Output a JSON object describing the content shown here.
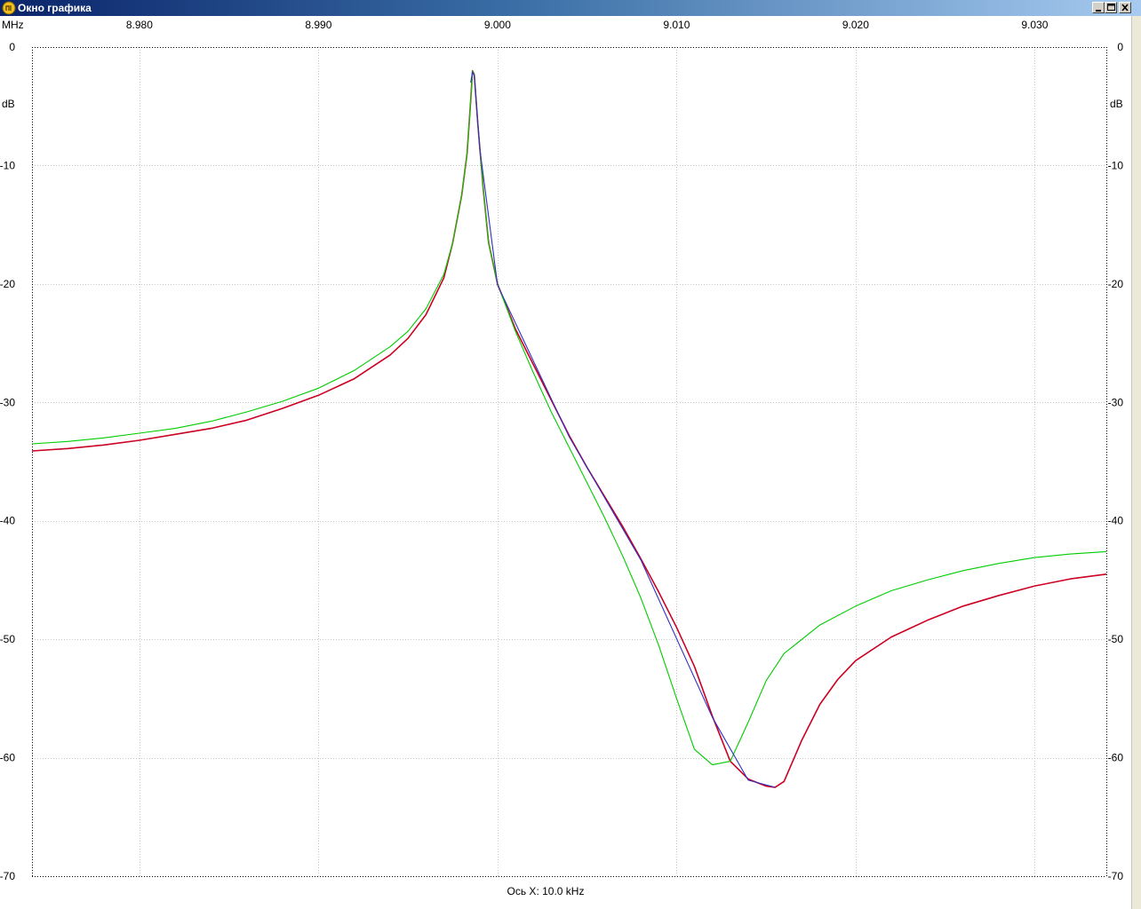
{
  "window": {
    "title": "Окно графика",
    "buttons": [
      "minimize",
      "maximize",
      "close"
    ]
  },
  "chart_data": {
    "type": "line",
    "x_unit": "MHz",
    "y_unit": "dB",
    "xlim": [
      8.974,
      9.034
    ],
    "ylim": [
      -70,
      0
    ],
    "x_ticks": [
      {
        "value": 8.98,
        "label": "8.980"
      },
      {
        "value": 8.99,
        "label": "8.990"
      },
      {
        "value": 9.0,
        "label": "9.000"
      },
      {
        "value": 9.01,
        "label": "9.010"
      },
      {
        "value": 9.02,
        "label": "9.020"
      },
      {
        "value": 9.03,
        "label": "9.030"
      }
    ],
    "y_ticks": [
      {
        "value": 0,
        "label": "0"
      },
      {
        "value": -10,
        "label": "-10"
      },
      {
        "value": -20,
        "label": "-20"
      },
      {
        "value": -30,
        "label": "-30"
      },
      {
        "value": -40,
        "label": "-40"
      },
      {
        "value": -50,
        "label": "-50"
      },
      {
        "value": -60,
        "label": "-60"
      },
      {
        "value": -70,
        "label": "-70"
      }
    ],
    "x_axis_caption": "Ось X: 10.0 kHz",
    "grid": true,
    "series": [
      {
        "color": "#cc0022",
        "points": [
          [
            8.974,
            -34.1
          ],
          [
            8.976,
            -33.9
          ],
          [
            8.978,
            -33.6
          ],
          [
            8.98,
            -33.2
          ],
          [
            8.982,
            -32.7
          ],
          [
            8.984,
            -32.2
          ],
          [
            8.986,
            -31.5
          ],
          [
            8.988,
            -30.5
          ],
          [
            8.99,
            -29.4
          ],
          [
            8.992,
            -28.0
          ],
          [
            8.994,
            -26.0
          ],
          [
            8.995,
            -24.6
          ],
          [
            8.996,
            -22.6
          ],
          [
            8.997,
            -19.5
          ],
          [
            8.9975,
            -16.5
          ],
          [
            8.998,
            -12.5
          ],
          [
            8.9983,
            -9.0
          ],
          [
            8.9985,
            -4.5
          ],
          [
            8.9986,
            -2.0
          ],
          [
            8.9987,
            -2.3
          ],
          [
            8.9989,
            -6.5
          ],
          [
            8.9992,
            -12.0
          ],
          [
            8.9995,
            -16.5
          ],
          [
            9.0,
            -20.0
          ],
          [
            9.001,
            -23.8
          ],
          [
            9.002,
            -26.8
          ],
          [
            9.003,
            -29.8
          ],
          [
            9.004,
            -32.8
          ],
          [
            9.005,
            -35.5
          ],
          [
            9.006,
            -38.0
          ],
          [
            9.007,
            -40.5
          ],
          [
            9.008,
            -43.2
          ],
          [
            9.009,
            -46.0
          ],
          [
            9.01,
            -49.0
          ],
          [
            9.011,
            -52.3
          ],
          [
            9.012,
            -56.5
          ],
          [
            9.013,
            -60.3
          ],
          [
            9.014,
            -61.8
          ],
          [
            9.015,
            -62.4
          ],
          [
            9.0155,
            -62.5
          ],
          [
            9.016,
            -62.0
          ],
          [
            9.017,
            -58.5
          ],
          [
            9.018,
            -55.5
          ],
          [
            9.019,
            -53.4
          ],
          [
            9.02,
            -51.8
          ],
          [
            9.022,
            -49.8
          ],
          [
            9.024,
            -48.4
          ],
          [
            9.026,
            -47.2
          ],
          [
            9.028,
            -46.3
          ],
          [
            9.03,
            -45.5
          ],
          [
            9.032,
            -44.9
          ],
          [
            9.034,
            -44.5
          ]
        ]
      },
      {
        "color": "#00cc00",
        "points": [
          [
            8.974,
            -33.5
          ],
          [
            8.976,
            -33.3
          ],
          [
            8.978,
            -33.0
          ],
          [
            8.98,
            -32.6
          ],
          [
            8.982,
            -32.2
          ],
          [
            8.984,
            -31.6
          ],
          [
            8.986,
            -30.8
          ],
          [
            8.988,
            -29.9
          ],
          [
            8.99,
            -28.8
          ],
          [
            8.992,
            -27.3
          ],
          [
            8.994,
            -25.3
          ],
          [
            8.995,
            -24.0
          ],
          [
            8.996,
            -22.1
          ],
          [
            8.997,
            -19.2
          ],
          [
            8.9975,
            -16.5
          ],
          [
            8.998,
            -12.5
          ],
          [
            8.9983,
            -9.0
          ],
          [
            8.9985,
            -4.5
          ],
          [
            8.9986,
            -2.0
          ],
          [
            8.9987,
            -2.3
          ],
          [
            8.9989,
            -6.5
          ],
          [
            8.9992,
            -12.0
          ],
          [
            8.9995,
            -16.5
          ],
          [
            9.0,
            -20.0
          ],
          [
            9.001,
            -24.0
          ],
          [
            9.002,
            -27.5
          ],
          [
            9.003,
            -30.8
          ],
          [
            9.004,
            -33.8
          ],
          [
            9.005,
            -36.8
          ],
          [
            9.006,
            -39.8
          ],
          [
            9.007,
            -43.0
          ],
          [
            9.008,
            -46.5
          ],
          [
            9.009,
            -50.5
          ],
          [
            9.01,
            -55.0
          ],
          [
            9.011,
            -59.3
          ],
          [
            9.012,
            -60.6
          ],
          [
            9.013,
            -60.3
          ],
          [
            9.014,
            -57.0
          ],
          [
            9.015,
            -53.5
          ],
          [
            9.016,
            -51.2
          ],
          [
            9.018,
            -48.8
          ],
          [
            9.02,
            -47.2
          ],
          [
            9.022,
            -45.9
          ],
          [
            9.024,
            -45.0
          ],
          [
            9.026,
            -44.2
          ],
          [
            9.028,
            -43.6
          ],
          [
            9.03,
            -43.1
          ],
          [
            9.032,
            -42.8
          ],
          [
            9.034,
            -42.6
          ]
        ]
      },
      {
        "color": "#3030c0",
        "points": [
          [
            8.9985,
            -3.0
          ],
          [
            8.9986,
            -2.1
          ],
          [
            8.9987,
            -2.4
          ],
          [
            8.999,
            -8.5
          ],
          [
            9.0,
            -20.1
          ],
          [
            9.004,
            -32.9
          ],
          [
            9.008,
            -43.3
          ],
          [
            9.012,
            -56.6
          ],
          [
            9.014,
            -61.9
          ],
          [
            9.0155,
            -62.5
          ]
        ]
      }
    ]
  }
}
